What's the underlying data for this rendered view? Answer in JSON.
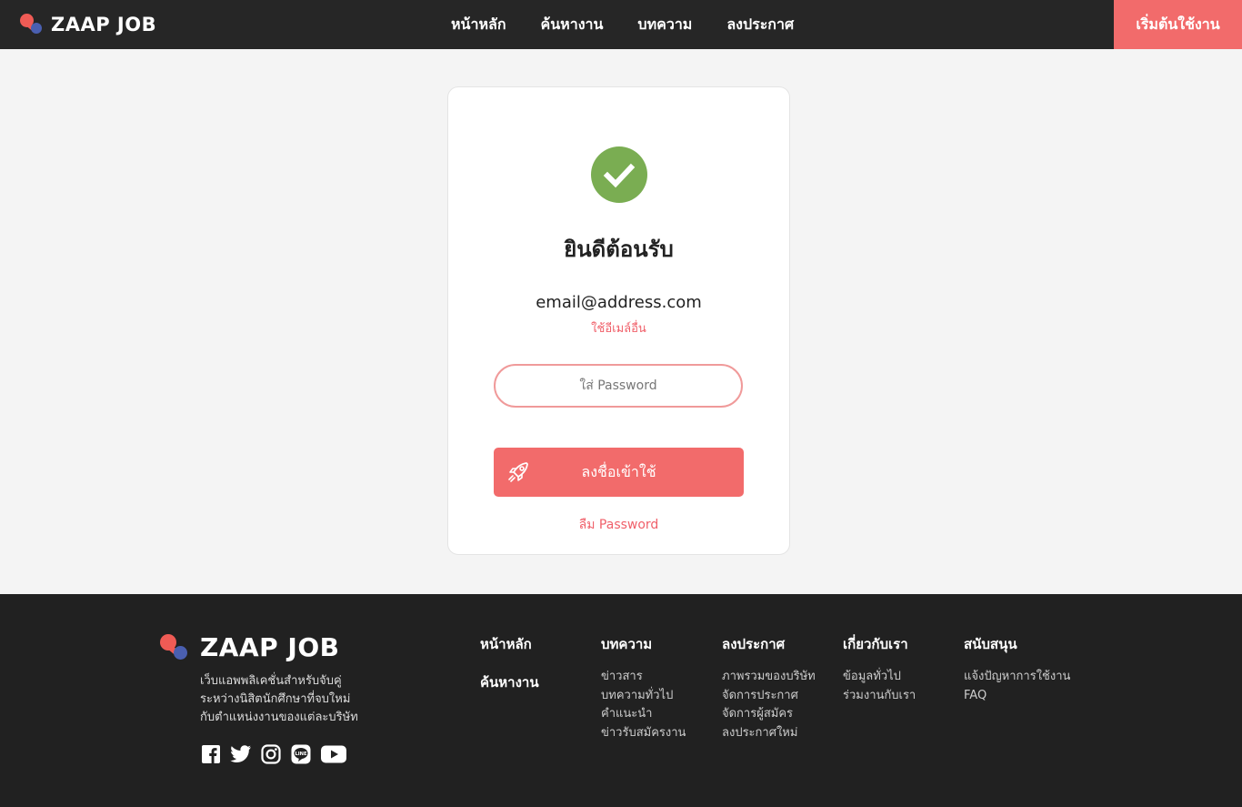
{
  "header": {
    "brand": "ZAAP JOB",
    "nav": [
      "หน้าหลัก",
      "ค้นหางาน",
      "บทความ",
      "ลงประกาศ"
    ],
    "cta": "เริ่มต้นใช้งาน"
  },
  "login": {
    "title": "ยินดีต้อนรับ",
    "email": "email@address.com",
    "other_email": "ใช้อีเมล์อื่น",
    "password_placeholder": "ใส่ Password",
    "login_button": "ลงชื่อเข้าใช้",
    "forgot": "ลืม Password"
  },
  "footer": {
    "brand": "ZAAP JOB",
    "tagline": [
      "เว็บแอพพลิเคชั่นสำหรับจับคู่",
      "ระหว่างนิสิตนักศึกษาที่จบใหม่",
      "กับตำแหน่งงานของแต่ละบริษัท"
    ],
    "socials": [
      "facebook-icon",
      "twitter-icon",
      "instagram-icon",
      "line-icon",
      "youtube-icon"
    ],
    "col_home": {
      "head": "หน้าหลัก",
      "head2": "ค้นหางาน"
    },
    "col_articles": {
      "head": "บทความ",
      "links": [
        "ข่าวสาร",
        "บทความทั่วไป",
        "คำแนะนำ",
        "ข่าวรับสมัครงาน"
      ]
    },
    "col_post": {
      "head": "ลงประกาศ",
      "links": [
        "ภาพรวมของบริษัท",
        "จัดการประกาศ",
        "จัดการผู้สมัคร",
        "ลงประกาศใหม่"
      ]
    },
    "col_about": {
      "head": "เกี่ยวกับเรา",
      "links": [
        "ข้อมูลทั่วไป",
        "ร่วมงานกับเรา"
      ]
    },
    "col_support": {
      "head": "สนับสนุน",
      "links": [
        "แจ้งปัญหาการใช้งาน",
        "FAQ"
      ]
    }
  },
  "colors": {
    "accent": "#f26b6b",
    "success": "#7aad52",
    "dark": "#262626"
  }
}
